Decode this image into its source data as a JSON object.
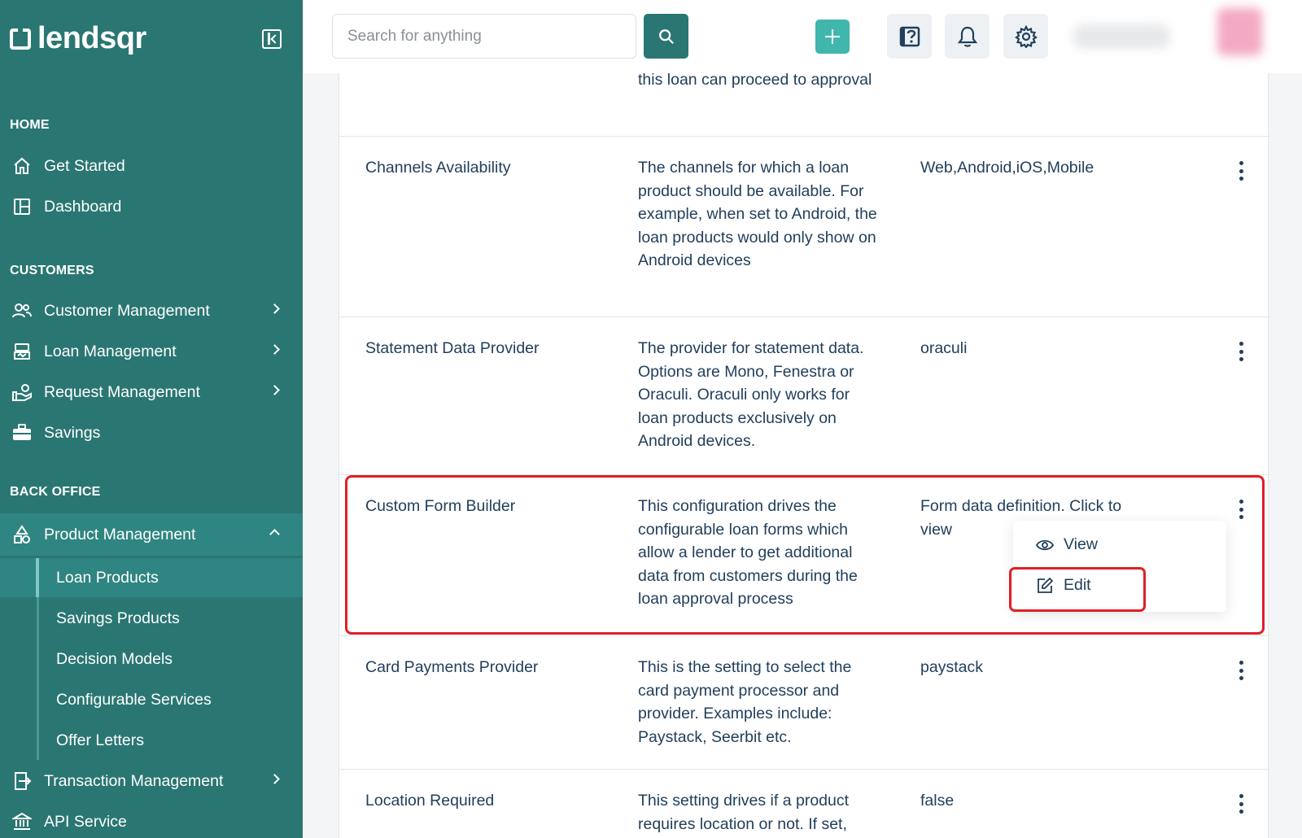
{
  "brand": {
    "name": "lendsqr"
  },
  "sidebar": {
    "sections": {
      "home": "HOME",
      "customers": "CUSTOMERS",
      "back_office": "BACK OFFICE"
    },
    "home_items": [
      {
        "label": "Get Started",
        "icon": "home-icon"
      },
      {
        "label": "Dashboard",
        "icon": "dashboard-icon"
      }
    ],
    "customer_items": [
      {
        "label": "Customer Management",
        "icon": "users-icon"
      },
      {
        "label": "Loan Management",
        "icon": "loan-icon"
      },
      {
        "label": "Request Management",
        "icon": "request-icon"
      },
      {
        "label": "Savings",
        "icon": "briefcase-icon"
      }
    ],
    "back_office_items": {
      "product_management": "Product Management",
      "sub_items": [
        "Loan Products",
        "Savings Products",
        "Decision Models",
        "Configurable Services",
        "Offer Letters"
      ],
      "transaction_management": "Transaction Management",
      "api_service": "API Service"
    }
  },
  "header": {
    "search_placeholder": "Search for anything"
  },
  "table": {
    "rows": [
      {
        "name": "",
        "description": "this loan can proceed to approval",
        "value": ""
      },
      {
        "name": "Channels Availability",
        "description": "The channels for which a loan product should be available. For example, when set to Android, the loan products would only show on Android devices",
        "value": "Web,Android,iOS,Mobile"
      },
      {
        "name": "Statement Data Provider",
        "description": "The provider for statement data. Options are Mono, Fenestra or Oraculi. Oraculi only works for loan products exclusively on Android devices.",
        "value": "oraculi"
      },
      {
        "name": "Custom Form Builder",
        "description": "This configuration drives the configurable loan forms which allow a lender to get additional data from customers during the loan approval process",
        "value": "Form data definition. Click to view"
      },
      {
        "name": "Card Payments Provider",
        "description": "This is the setting to select the card payment processor and provider. Examples include: Paystack, Seerbit etc.",
        "value": "paystack"
      },
      {
        "name": "Location Required",
        "description": "This setting drives if a product requires location or not. If set,",
        "value": "false"
      }
    ]
  },
  "dropdown": {
    "view_label": "View",
    "edit_label": "Edit"
  },
  "colors": {
    "sidebar_bg": "#2a7672",
    "accent": "#40b6ad",
    "highlight": "#e01f26",
    "text": "#213f5c"
  }
}
